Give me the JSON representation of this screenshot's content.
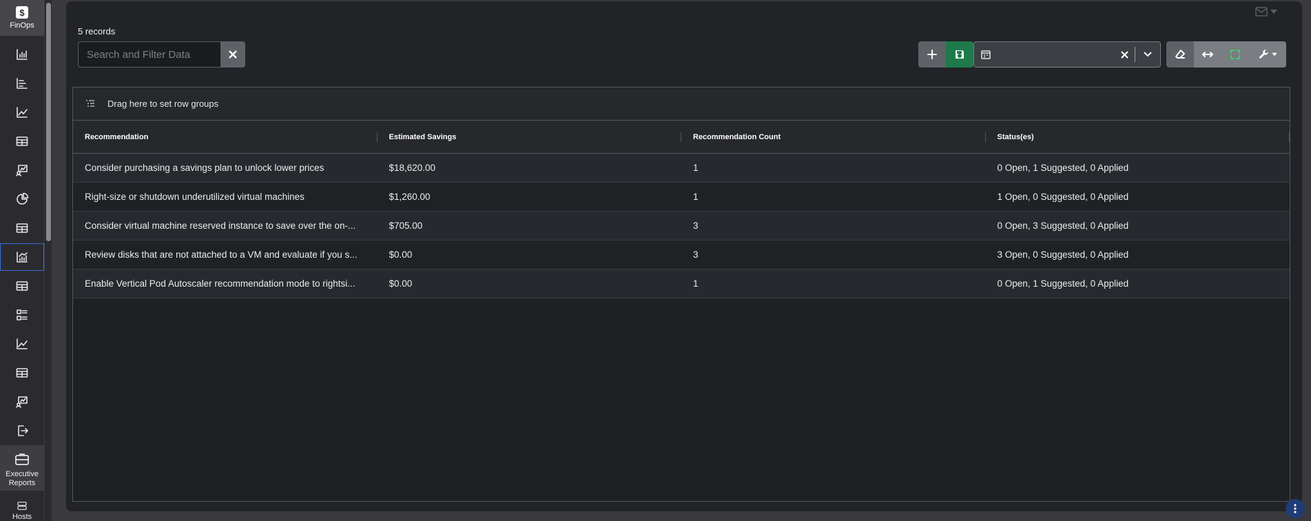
{
  "sidebar": {
    "brand": {
      "symbol": "$",
      "label": "FinOps"
    },
    "items": [
      {
        "icon": "bar-chart-icon"
      },
      {
        "icon": "horizontal-bar-chart-icon"
      },
      {
        "icon": "line-chart-icon"
      },
      {
        "icon": "table-icon"
      },
      {
        "icon": "presentation-chart-icon"
      },
      {
        "icon": "pie-chart-icon"
      },
      {
        "icon": "table-icon"
      },
      {
        "icon": "combo-chart-icon",
        "active": true
      },
      {
        "icon": "table-icon"
      },
      {
        "icon": "list-icon"
      },
      {
        "icon": "line-chart-icon"
      },
      {
        "icon": "table-icon"
      },
      {
        "icon": "presentation-chart-icon"
      },
      {
        "icon": "export-icon"
      }
    ],
    "executive_reports": {
      "label_line1": "Executive",
      "label_line2": "Reports"
    },
    "hosts": {
      "label": "Hosts"
    }
  },
  "header": {
    "records": "5 records",
    "search": {
      "placeholder": "Search and Filter Data",
      "value": ""
    },
    "view_select": {
      "value": ""
    }
  },
  "grid": {
    "group_hint": "Drag here to set row groups",
    "columns": [
      "Recommendation",
      "Estimated Savings",
      "Recommendation Count",
      "Status(es)"
    ],
    "rows": [
      [
        "Consider purchasing a savings plan to unlock lower prices",
        "$18,620.00",
        "1",
        "0 Open, 1 Suggested, 0 Applied"
      ],
      [
        "Right-size or shutdown underutilized virtual machines",
        "$1,260.00",
        "1",
        "1 Open, 0 Suggested, 0 Applied"
      ],
      [
        "Consider virtual machine reserved instance to save over the on-...",
        "$705.00",
        "3",
        "0 Open, 3 Suggested, 0 Applied"
      ],
      [
        "Review disks that are not attached to a VM and evaluate if you s...",
        "$0.00",
        "3",
        "3 Open, 0 Suggested, 0 Applied"
      ],
      [
        "Enable Vertical Pod Autoscaler recommendation mode to rightsi...",
        "$0.00",
        "1",
        "0 Open, 1 Suggested, 0 Applied"
      ]
    ]
  },
  "colors": {
    "accent_green": "#1e7a4a",
    "active_border": "#3b6fd8"
  }
}
